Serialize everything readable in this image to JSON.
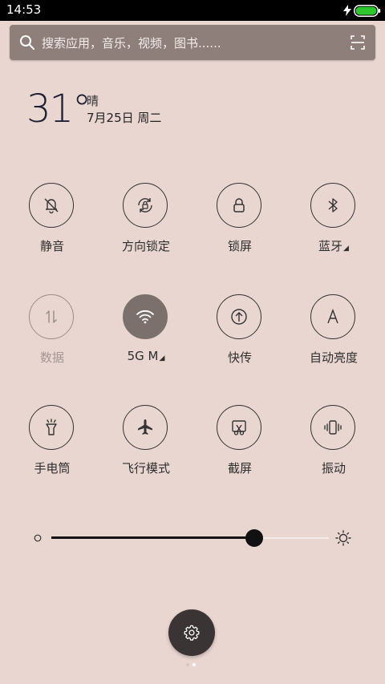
{
  "status_bar": {
    "time": "14:53",
    "battery_color": "#2ec62e"
  },
  "search": {
    "placeholder": "搜索应用，音乐，视频，图书......"
  },
  "weather": {
    "temperature": "31°",
    "condition": "晴",
    "date": "7月25日 周二"
  },
  "toggles": [
    {
      "label": "静音",
      "icon": "mute-bell-icon",
      "state": "off"
    },
    {
      "label": "方向锁定",
      "icon": "rotation-lock-icon",
      "state": "off"
    },
    {
      "label": "锁屏",
      "icon": "lock-icon",
      "state": "off"
    },
    {
      "label": "蓝牙",
      "icon": "bluetooth-icon",
      "state": "off",
      "has_more": true
    },
    {
      "label": "数据",
      "icon": "mobile-data-icon",
      "state": "disabled"
    },
    {
      "label": "5G   M",
      "icon": "wifi-icon",
      "state": "on",
      "has_more": true
    },
    {
      "label": "快传",
      "icon": "quick-transfer-icon",
      "state": "off"
    },
    {
      "label": "自动亮度",
      "icon": "auto-brightness-icon",
      "state": "off"
    },
    {
      "label": "手电筒",
      "icon": "flashlight-icon",
      "state": "off"
    },
    {
      "label": "飞行模式",
      "icon": "airplane-icon",
      "state": "off"
    },
    {
      "label": "截屏",
      "icon": "screenshot-icon",
      "state": "off"
    },
    {
      "label": "振动",
      "icon": "vibrate-icon",
      "state": "off"
    }
  ],
  "brightness": {
    "level": 0.73
  },
  "pager": {
    "count": 2,
    "active_index": 1
  },
  "colors": {
    "background": "#ead6d1",
    "active_tile": "#7c706d",
    "search_bar": "#8e7f7b",
    "settings_button": "#3a3434"
  }
}
